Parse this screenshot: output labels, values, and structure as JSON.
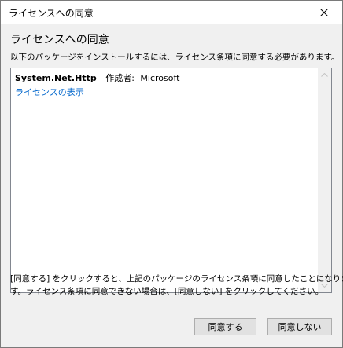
{
  "window": {
    "title": "ライセンスへの同意"
  },
  "header": {
    "heading": "ライセンスへの同意",
    "subtitle": "以下のパッケージをインストールするには、ライセンス条項に同意する必要があります。"
  },
  "packages": [
    {
      "id": "System.Net.Http",
      "author_label": "作成者:",
      "author": "Microsoft",
      "license_link": "ライセンスの表示"
    }
  ],
  "footer": {
    "line1": "[同意する] をクリックすると、上記のパッケージのライセンス条項に同意したことになりま",
    "line2": "す。ライセンス条項に同意できない場合は、[同意しない] をクリックしてください。"
  },
  "buttons": {
    "accept": "同意する",
    "decline": "同意しない"
  },
  "icons": {
    "close": "close-icon",
    "scroll_up": "chevron-up-icon",
    "scroll_down": "chevron-down-icon"
  },
  "colors": {
    "link": "#0066cc",
    "dialog_background": "#f0f0f0",
    "button_background": "#e1e1e1"
  }
}
